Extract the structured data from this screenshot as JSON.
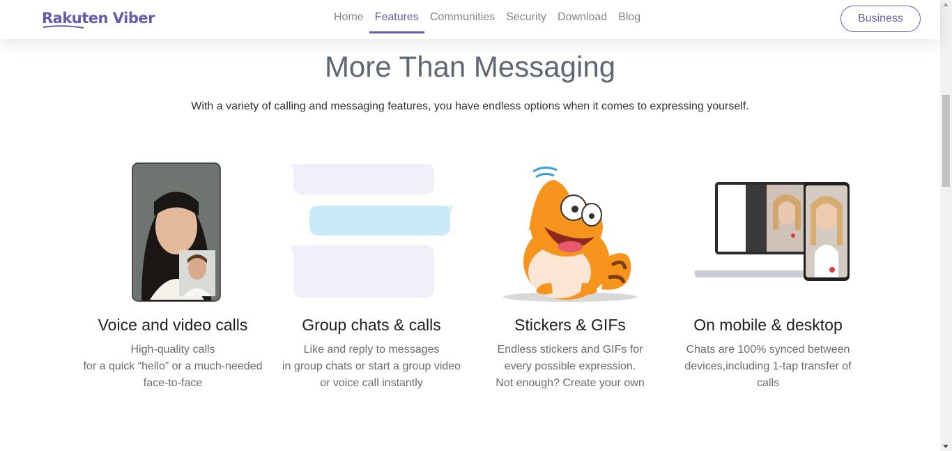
{
  "header": {
    "logo": "Rakuten Viber",
    "nav": [
      "Home",
      "Features",
      "Communities",
      "Security",
      "Download",
      "Blog"
    ],
    "active_nav": "Features",
    "business_label": "Business"
  },
  "section": {
    "title": "More Than Messaging",
    "subtitle": "With a variety of calling and messaging features, you have endless options when it comes to expressing yourself."
  },
  "features": [
    {
      "title": "Voice and video calls",
      "lines": [
        "High-quality calls",
        "for a quick “hello” or a much-needed",
        "face-to-face"
      ]
    },
    {
      "title": "Group chats & calls",
      "lines": [
        "Like and reply to messages",
        "in group chats or start a group video",
        "or voice call instantly"
      ]
    },
    {
      "title": "Stickers & GIFs",
      "lines": [
        "Endless stickers and GIFs for",
        "every possible expression.",
        "Not enough? Create your own"
      ]
    },
    {
      "title": "On mobile & desktop",
      "lines": [
        "Chats are 100% synced between",
        "devices,including 1-tap transfer of",
        "calls"
      ]
    }
  ],
  "colors": {
    "brand": "#665cac",
    "bubble_grey": "#f0f1f8",
    "bubble_blue": "#cbeaf8",
    "cat_orange": "#f7941d"
  }
}
